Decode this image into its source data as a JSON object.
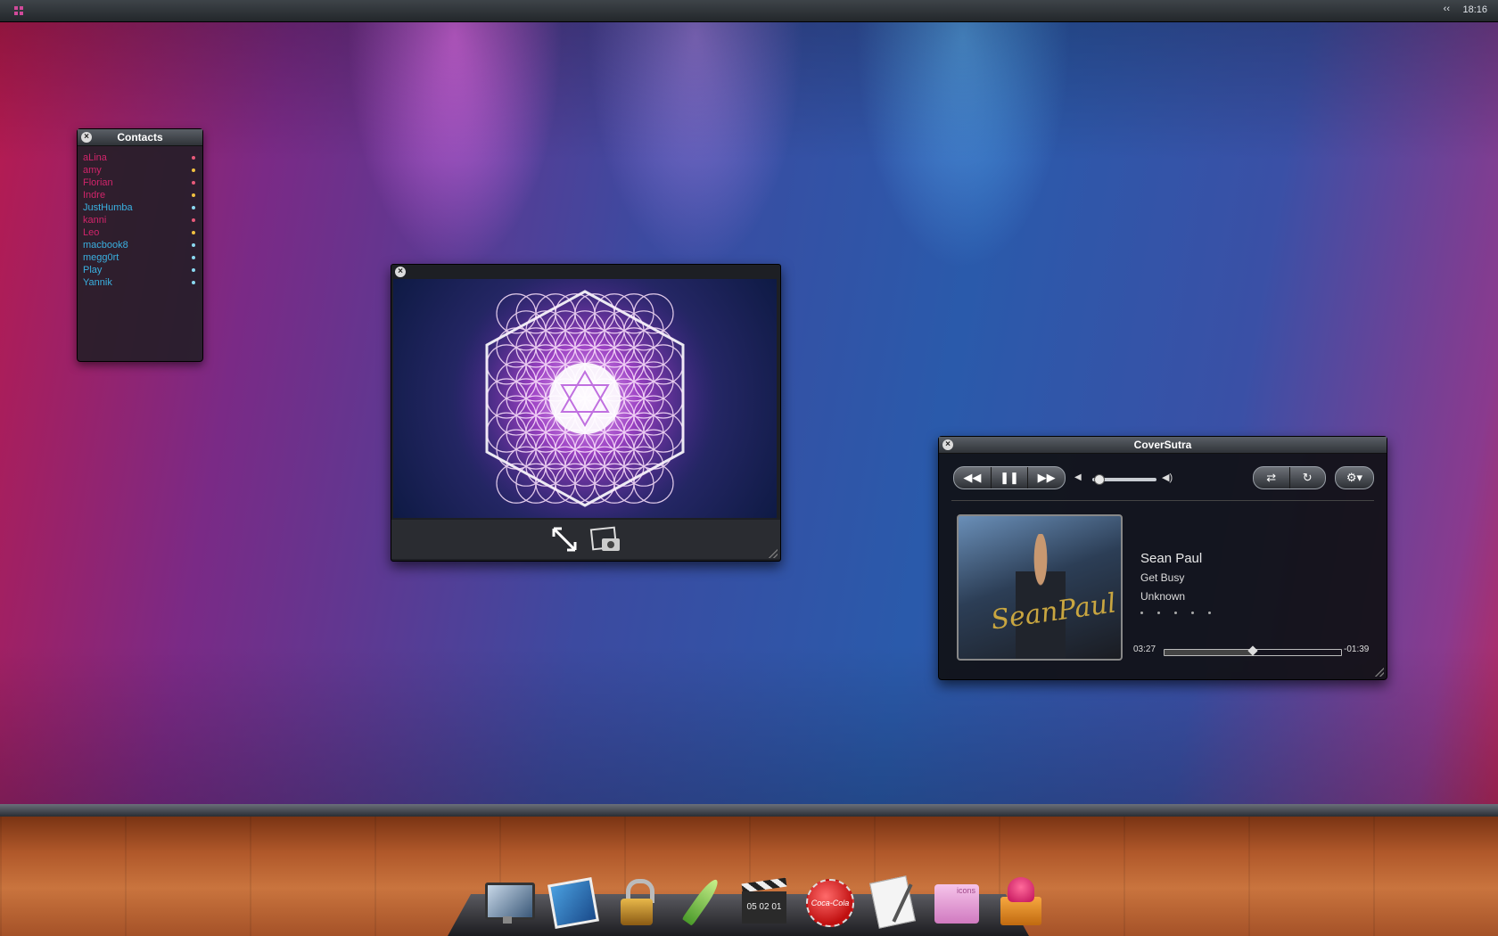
{
  "menubar": {
    "clock": "18:16",
    "collapse_glyph": "‹‹"
  },
  "contacts": {
    "title": "Contacts",
    "items": [
      {
        "name": "aLina",
        "color": "#d0246a",
        "status_color": "#e85a7a"
      },
      {
        "name": "amy",
        "color": "#d0246a",
        "status_color": "#f0c040"
      },
      {
        "name": "Florian",
        "color": "#d0246a",
        "status_color": "#e85a7a"
      },
      {
        "name": "Indre",
        "color": "#d0246a",
        "status_color": "#f0c040"
      },
      {
        "name": "JustHumba",
        "color": "#3ab0e0",
        "status_color": "#8ad8f0"
      },
      {
        "name": "kanni",
        "color": "#d0246a",
        "status_color": "#e85a7a"
      },
      {
        "name": "Leo",
        "color": "#d0246a",
        "status_color": "#f0c040"
      },
      {
        "name": "macbook8",
        "color": "#3ab0e0",
        "status_color": "#8ad8f0"
      },
      {
        "name": "megg0rt",
        "color": "#3ab0e0",
        "status_color": "#8ad8f0"
      },
      {
        "name": "Play",
        "color": "#3ab0e0",
        "status_color": "#8ad8f0"
      },
      {
        "name": "Yannik",
        "color": "#3ab0e0",
        "status_color": "#8ad8f0"
      }
    ]
  },
  "viewer": {
    "icons": [
      "expand-arrows-icon",
      "camera-snapshot-icon"
    ]
  },
  "player": {
    "title": "CoverSutra",
    "artist": "Sean Paul",
    "track": "Get Busy",
    "album": "Unknown",
    "album_art_text": "SeanPaul",
    "elapsed": "03:27",
    "remaining": "-01:39",
    "progress_fraction": 0.5,
    "volume_fraction": 0.05,
    "rating_dots": 5,
    "controls": {
      "rewind": "rewind-icon",
      "pause": "pause-icon",
      "forward": "fast-forward-icon",
      "shuffle": "shuffle-icon",
      "repeat": "repeat-icon",
      "settings": "gear-icon"
    }
  },
  "dock": {
    "items": [
      {
        "name": "monitor-icon"
      },
      {
        "name": "photos-icon"
      },
      {
        "name": "padlock-icon"
      },
      {
        "name": "quill-icon"
      },
      {
        "name": "clapperboard-icon",
        "label": "05 02 01"
      },
      {
        "name": "coca-cola-cap-icon",
        "label": "Coca-Cola"
      },
      {
        "name": "textedit-icon"
      },
      {
        "name": "icons-folder-icon",
        "label": "icons"
      },
      {
        "name": "gift-heart-icon"
      }
    ]
  }
}
